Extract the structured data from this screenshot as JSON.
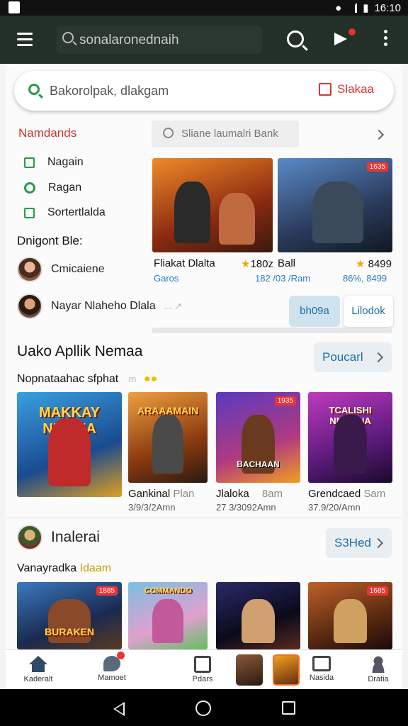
{
  "status_bar": {
    "time": "16:10"
  },
  "app_bar": {
    "search_placeholder": "sonalaronednaih",
    "icons": [
      "menu-icon",
      "search-icon",
      "megaphone-icon",
      "more-icon"
    ]
  },
  "main_search": {
    "placeholder": "Bakorolpak, dlakgam",
    "action_label": "Slakaa"
  },
  "sidebar": {
    "section_title": "Namdands",
    "items": [
      {
        "label": "Nagain",
        "icon": "square-icon"
      },
      {
        "label": "Ragan",
        "icon": "gear-icon"
      },
      {
        "label": "Sortertlalda",
        "icon": "check-icon"
      }
    ],
    "people_title": "Dnigont Ble:",
    "people": [
      {
        "name": "Cmicaiene"
      },
      {
        "name": "Nayar Nlaheho Dlala"
      }
    ],
    "people_suffix": "... ↗"
  },
  "featured": {
    "search_placeholder": "Sliane laumalri Bank",
    "cards": [
      {
        "name": "Fliakat Dlalta",
        "rating": "180z",
        "sub": "Garos",
        "meta": "182 /03 /Ram"
      },
      {
        "name": "Ball",
        "rating": "8499",
        "sub": "",
        "meta": "86%, 8499",
        "badge": "1635"
      }
    ],
    "btn_primary": "bh09a",
    "btn_secondary": "Lilodok"
  },
  "section1": {
    "title": "Uako Apllik Nemaa",
    "pill": "Poucarl",
    "subtitle": "Nopnataahac sfphat",
    "subtitle_tail": "m",
    "games": [
      {
        "art_title": "MAKKAY NIENEA",
        "name": "",
        "badge": ""
      },
      {
        "art_title": "ARAAAMAIN",
        "name": "Gankinal",
        "tag": "Plan",
        "meta": "3/9/3/2Amn"
      },
      {
        "art_title": "BACHAAN",
        "name": "Jlaloka",
        "tag": "8am",
        "meta": "27 3/3092Amn",
        "badge": "1935"
      },
      {
        "art_title": "TCALISHI NMMENA",
        "name": "Grendcaed",
        "tag": "Sam",
        "meta": "37.9/20/Amn"
      }
    ]
  },
  "section2": {
    "title": "Inalerai",
    "pill": "S3Hed",
    "subtitle": "Vanayradka",
    "subtitle_accent": "Idaam",
    "games": [
      {
        "art_title": "BURAKEN",
        "badge": "1885"
      },
      {
        "art_title": "COMMANDO"
      },
      {
        "art_title": ""
      },
      {
        "art_title": "",
        "badge": "1685"
      }
    ]
  },
  "bottom_nav": [
    {
      "label": "Kaderalt",
      "icon": "home-icon"
    },
    {
      "label": "Mamoet",
      "icon": "chat-badge-icon"
    },
    {
      "label": "Pdars",
      "icon": "news-icon"
    },
    {
      "label": "",
      "icon": "game-thumb-1"
    },
    {
      "label": "",
      "icon": "game-thumb-2"
    },
    {
      "label": "Nasida",
      "icon": "message-icon"
    },
    {
      "label": "Dratia",
      "icon": "profile-icon"
    }
  ],
  "colors": {
    "appbar": "#233028",
    "accent_green": "#2a9a4c",
    "accent_red": "#cc3333",
    "link_blue": "#1f6da0"
  }
}
